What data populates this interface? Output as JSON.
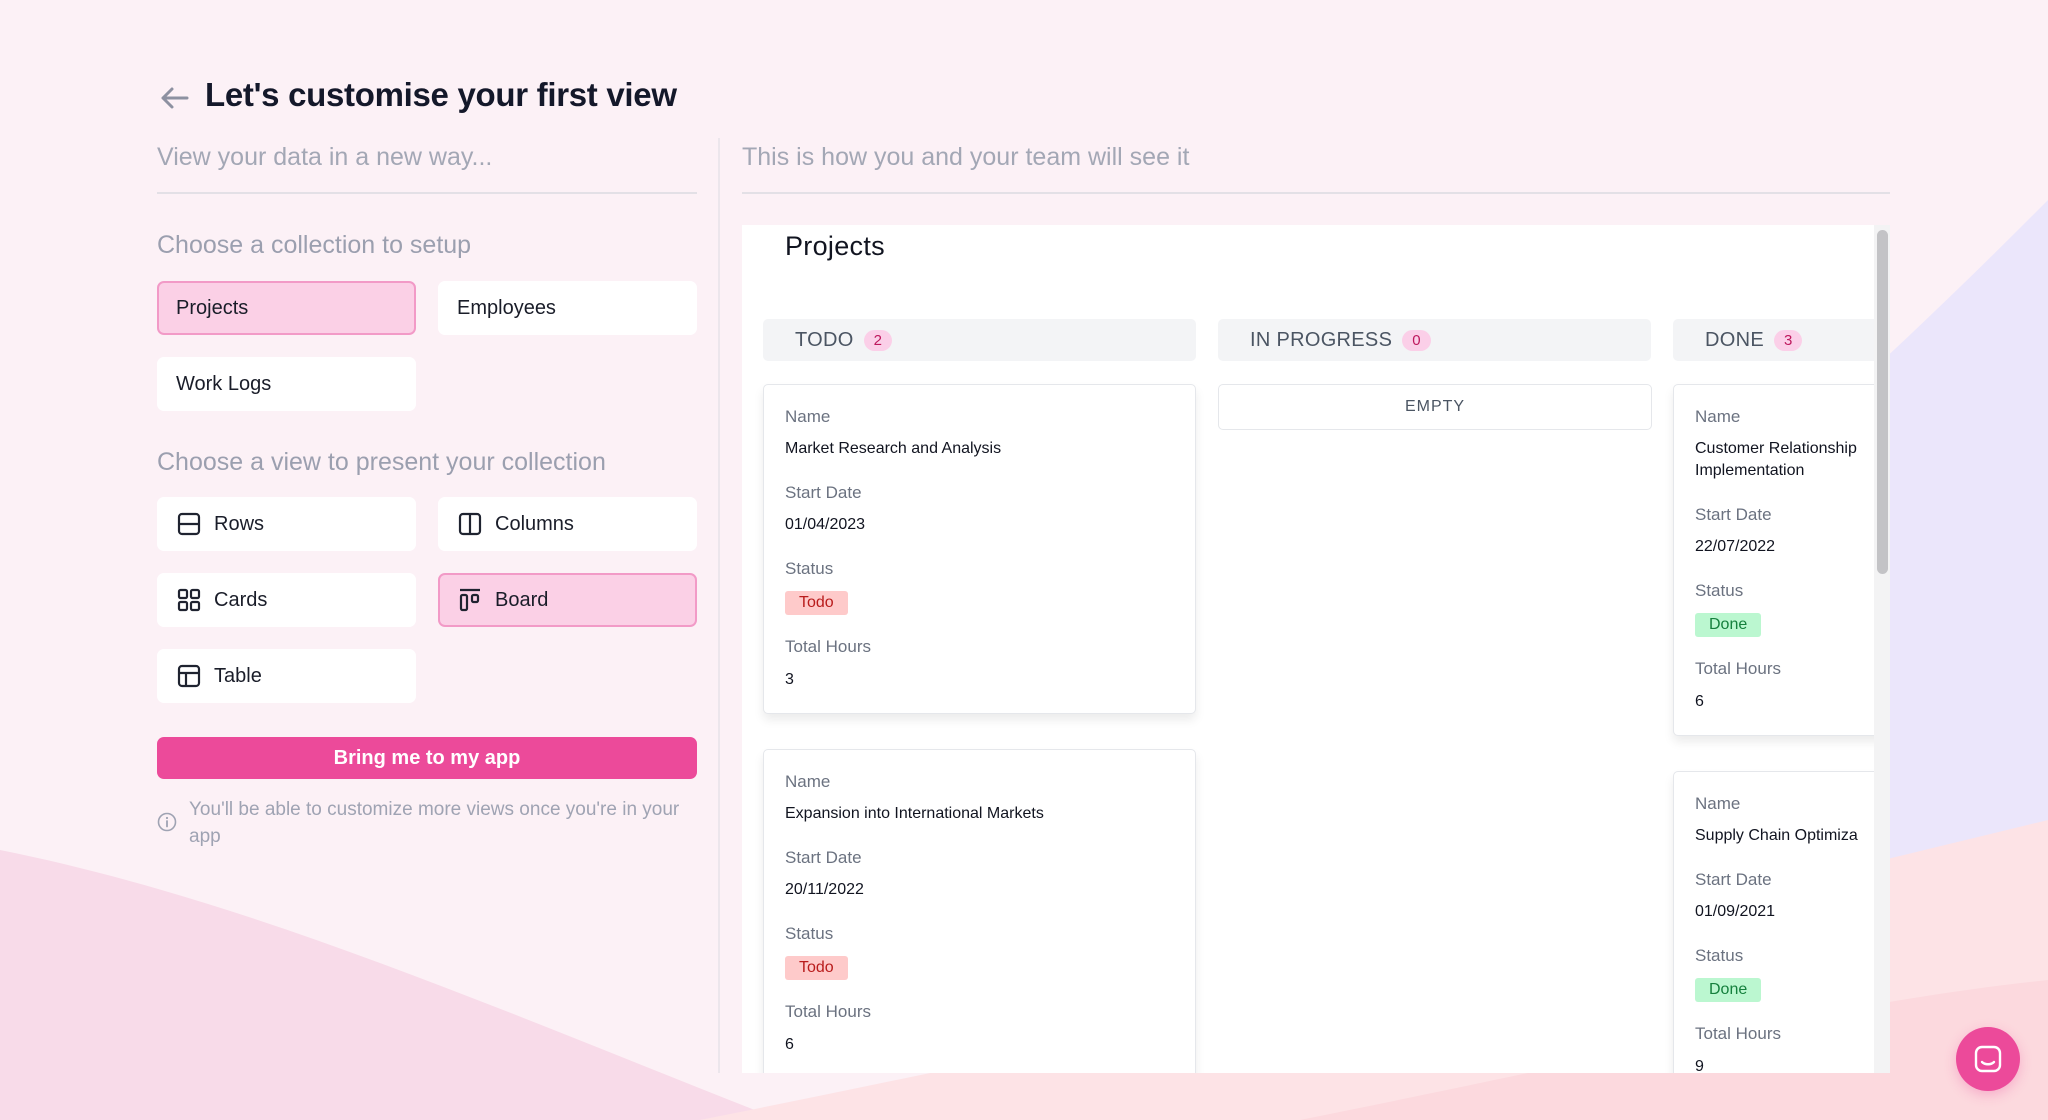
{
  "header": {
    "title": "Let's customise your first view"
  },
  "left": {
    "subtitle": "View your data in a new way...",
    "collection_label": "Choose a collection to setup",
    "collections": [
      "Projects",
      "Employees",
      "Work Logs"
    ],
    "view_label": "Choose a view to present your collection",
    "views": {
      "rows": "Rows",
      "columns": "Columns",
      "cards": "Cards",
      "board": "Board",
      "table": "Table"
    },
    "primary_button": "Bring me to my app",
    "note": "You'll be able to customize more views once you're in your app"
  },
  "right": {
    "subtitle": "This is how you and your team will see it",
    "preview_title": "Projects",
    "empty_label": "EMPTY",
    "field_labels": {
      "name": "Name",
      "start_date": "Start Date",
      "status": "Status",
      "total_hours": "Total Hours"
    },
    "columns": [
      {
        "label": "TODO",
        "count": "2",
        "cards": [
          {
            "name": "Market Research and Analysis",
            "start_date": "01/04/2023",
            "status": "Todo",
            "total_hours": "3"
          },
          {
            "name": "Expansion into International Markets",
            "start_date": "20/11/2022",
            "status": "Todo",
            "total_hours": "6"
          }
        ]
      },
      {
        "label": "IN PROGRESS",
        "count": "0",
        "cards": []
      },
      {
        "label": "DONE",
        "count": "3",
        "cards": [
          {
            "name": "Customer Relationship Implementation",
            "start_date": "22/07/2022",
            "status": "Done",
            "total_hours": "6"
          },
          {
            "name": "Supply Chain Optimiza",
            "start_date": "01/09/2021",
            "status": "Done",
            "total_hours": "9"
          }
        ]
      }
    ]
  },
  "colors": {
    "accent": "#ec4a9a",
    "selected_bg": "#fbd0e6",
    "selected_border": "#f29ac7",
    "todo_bg": "#fecaca",
    "done_bg": "#bbf7d0"
  },
  "icons": {
    "back": "arrow-left-icon",
    "rows": "rows-icon",
    "columns": "columns-icon",
    "cards": "grid-icon",
    "board": "kanban-icon",
    "table": "table-icon",
    "info": "info-icon",
    "chat": "chat-icon"
  }
}
